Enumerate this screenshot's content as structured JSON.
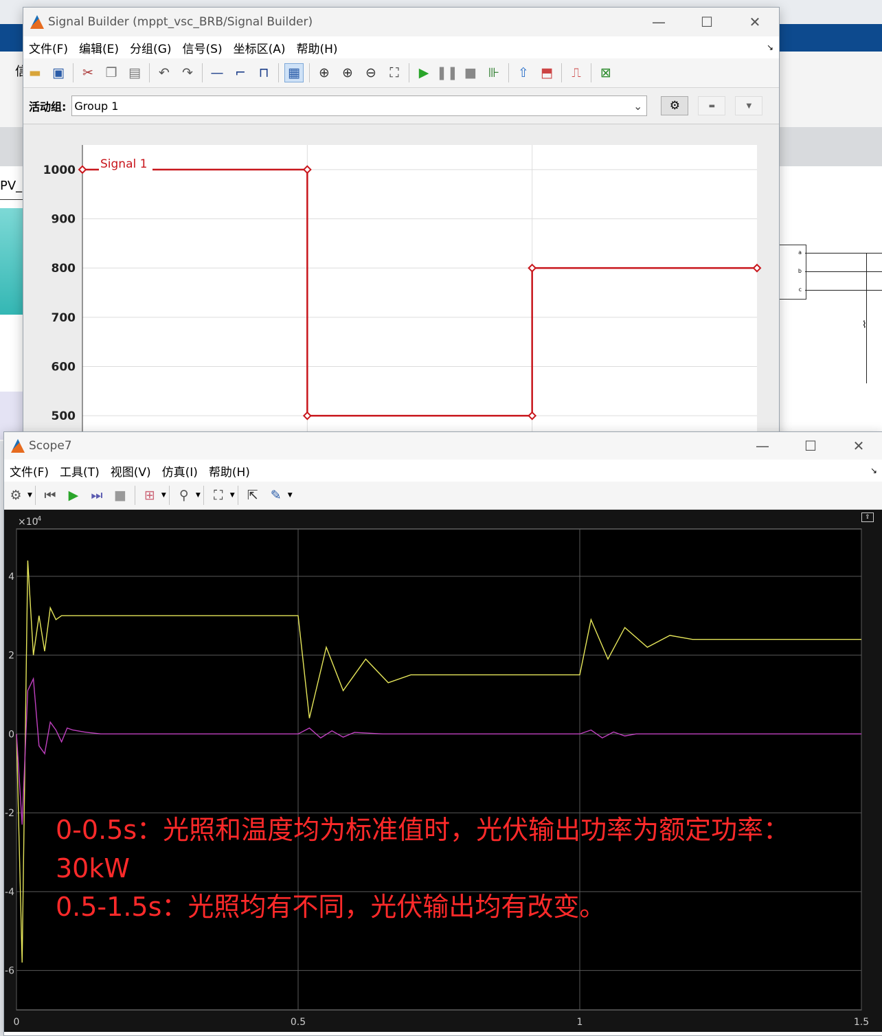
{
  "background": {
    "pv_label": "PV_",
    "block_ports": [
      "a",
      "b",
      "c"
    ],
    "bg_toolbar_glyph": "信"
  },
  "signal_builder": {
    "title": "Signal Builder (mppt_vsc_BRB/Signal Builder)",
    "menu": [
      "文件(F)",
      "编辑(E)",
      "分组(G)",
      "信号(S)",
      "坐标区(A)",
      "帮助(H)"
    ],
    "toolbar_icons": [
      "open-icon",
      "save-icon",
      "cut-icon",
      "copy-icon",
      "paste-icon",
      "undo-icon",
      "redo-icon",
      "constant-signal-icon",
      "step-signal-icon",
      "pulse-signal-icon",
      "grid-icon",
      "zoom-xy-icon",
      "zoom-x-icon",
      "zoom-out-icon",
      "fit-icon",
      "start-icon",
      "pause-icon",
      "stop-icon",
      "simulink-icon",
      "up-icon",
      "export-icon",
      "signal-icon",
      "help-icon"
    ],
    "active_group_label": "活动组:",
    "active_group_value": "Group 1",
    "signal_name": "Signal 1",
    "colors": {
      "signal": "#c8151b",
      "grid": "#dcdcdc"
    }
  },
  "scope": {
    "title": "Scope7",
    "menu": [
      "文件(F)",
      "工具(T)",
      "视图(V)",
      "仿真(I)",
      "帮助(H)"
    ],
    "toolbar_icons": [
      "settings-icon",
      "step-back-icon",
      "run-icon",
      "step-forward-icon",
      "stop-icon",
      "highlight-block-icon",
      "trigger-icon",
      "zoom-fit-icon",
      "cursor-icon",
      "style-icon"
    ],
    "exponent_label": "×10",
    "exponent_power": "4",
    "annotation_lines": [
      "0-0.5s：光照和温度均为标准值时，光伏输出功率为额定功率：",
      "30kW",
      "0.5-1.5s：光照均有不同，光伏输出均有改变。"
    ],
    "colors": {
      "trace1": "#e6e65a",
      "trace2": "#c040c0",
      "annotation": "#ff2a2a",
      "grid": "#5a5a5a"
    }
  },
  "chart_data": [
    {
      "type": "line",
      "title": "",
      "series": [
        {
          "name": "Signal 1",
          "x": [
            0,
            0.5,
            0.5,
            1.0,
            1.0,
            1.5
          ],
          "y": [
            1000,
            1000,
            500,
            500,
            800,
            800
          ]
        }
      ],
      "yticks": [
        "500",
        "600",
        "700",
        "800",
        "900",
        "1000"
      ],
      "xlim": [
        0,
        1.5
      ],
      "ylim": [
        450,
        1050
      ],
      "grid": true
    },
    {
      "type": "line",
      "title": "",
      "series": [
        {
          "x": [
            0,
            0.01,
            0.02,
            0.03,
            0.04,
            0.05,
            0.06,
            0.07,
            0.08,
            0.1,
            0.5,
            0.52,
            0.55,
            0.58,
            0.62,
            0.66,
            0.7,
            0.8,
            1.0,
            1.02,
            1.05,
            1.08,
            1.12,
            1.16,
            1.2,
            1.5
          ],
          "y": [
            0,
            -5.8,
            4.4,
            2.0,
            3.0,
            2.1,
            3.2,
            2.9,
            3.0,
            3.0,
            3.0,
            0.4,
            2.2,
            1.1,
            1.9,
            1.3,
            1.5,
            1.5,
            1.5,
            2.9,
            1.9,
            2.7,
            2.2,
            2.5,
            2.4,
            2.4
          ]
        },
        {
          "x": [
            0,
            0.01,
            0.02,
            0.03,
            0.04,
            0.05,
            0.06,
            0.07,
            0.08,
            0.09,
            0.1,
            0.12,
            0.15,
            0.5,
            0.52,
            0.54,
            0.56,
            0.58,
            0.6,
            0.65,
            1.0,
            1.02,
            1.04,
            1.06,
            1.08,
            1.1,
            1.5
          ],
          "y": [
            0,
            -2.3,
            1.1,
            1.4,
            -0.3,
            -0.5,
            0.3,
            0.1,
            -0.2,
            0.15,
            0.1,
            0.05,
            0,
            0,
            0.15,
            -0.1,
            0.08,
            -0.08,
            0.04,
            0,
            0,
            0.1,
            -0.1,
            0.05,
            -0.05,
            0,
            0
          ]
        }
      ],
      "xticks": [
        "0",
        "0.5",
        "1",
        "1.5"
      ],
      "yticks": [
        "-6",
        "-4",
        "-2",
        "0",
        "2",
        "4"
      ],
      "xlim": [
        0,
        1.5
      ],
      "ylim": [
        -7,
        5.2
      ],
      "grid": true
    }
  ]
}
